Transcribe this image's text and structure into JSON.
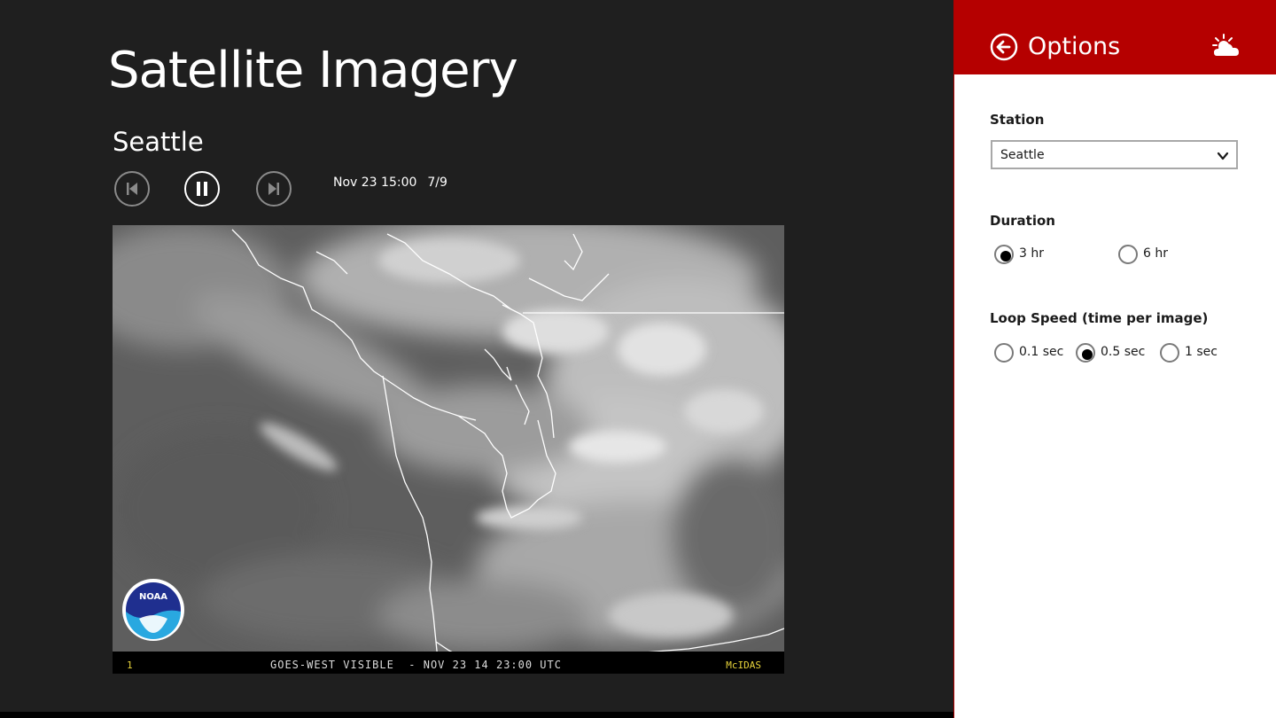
{
  "main": {
    "title": "Satellite Imagery",
    "station": "Seattle",
    "timestamp": "Nov 23 15:00",
    "frame": "7/9",
    "controls": {
      "prev_icon": "skip-back-icon",
      "pause_icon": "pause-icon",
      "next_icon": "skip-forward-icon"
    },
    "image": {
      "frame_number": "1",
      "caption": "GOES-WEST VISIBLE  - NOV 23 14 23:00 UTC",
      "source": "McIDAS",
      "logo_text": "NOAA"
    }
  },
  "panel": {
    "title": "Options",
    "back_icon": "back-arrow-icon",
    "app_icon": "sun-cloud-icon",
    "station_label": "Station",
    "station_value": "Seattle",
    "duration_label": "Duration",
    "duration_options": [
      {
        "label": "3 hr",
        "selected": true
      },
      {
        "label": "6 hr",
        "selected": false
      }
    ],
    "loop_label": "Loop Speed (time per image)",
    "loop_options": [
      {
        "label": "0.1 sec",
        "selected": false
      },
      {
        "label": "0.5 sec",
        "selected": true
      },
      {
        "label": "1 sec",
        "selected": false
      }
    ]
  },
  "colors": {
    "background": "#1f1f1f",
    "panel_header": "#b50000",
    "panel_bg": "#ffffff",
    "caption_accent": "#e6d23a"
  }
}
